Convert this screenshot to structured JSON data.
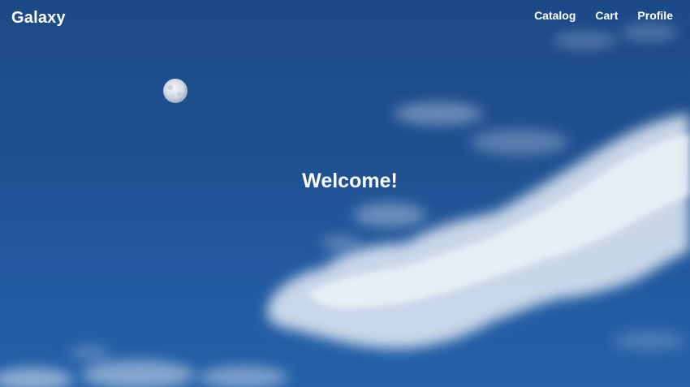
{
  "header": {
    "brand": "Galaxy",
    "nav": [
      {
        "label": "Catalog"
      },
      {
        "label": "Cart"
      },
      {
        "label": "Profile"
      }
    ]
  },
  "hero": {
    "heading": "Welcome!",
    "background": "sky-with-moon-and-clouds"
  },
  "colors": {
    "sky_top": "#1c4a86",
    "sky_bottom": "#2461a8",
    "text": "#ffffff"
  }
}
